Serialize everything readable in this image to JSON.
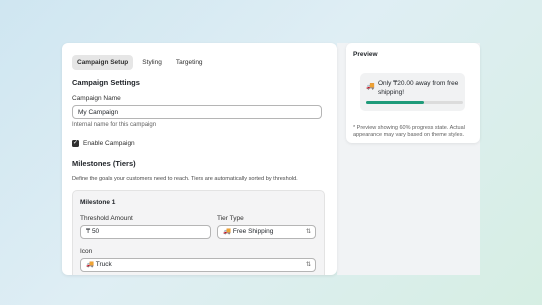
{
  "tabs": [
    "Campaign Setup",
    "Styling",
    "Targeting"
  ],
  "campaign_settings": {
    "heading": "Campaign Settings",
    "name_label": "Campaign Name",
    "name_value": "My Campaign",
    "name_help": "Internal name for this campaign",
    "enable_label": "Enable Campaign"
  },
  "milestones": {
    "heading": "Milestones (Tiers)",
    "description": "Define the goals your customers need to reach. Tiers are automatically sorted by threshold.",
    "milestone_title": "Milestone 1",
    "threshold_label": "Threshold Amount",
    "threshold_value": "₸ 50",
    "tier_type_label": "Tier Type",
    "tier_type_value": "🚚 Free Shipping",
    "icon_label": "Icon",
    "icon_value": "🚚 Truck"
  },
  "preview": {
    "title": "Preview",
    "icon": "🚚",
    "message": "Only ₸20.00 away from free shipping!",
    "progress_fraction": 0.6,
    "progress_color": "#1f9b7a",
    "note": "* Preview showing 60% progress state. Actual appearance may vary based on theme styles."
  }
}
